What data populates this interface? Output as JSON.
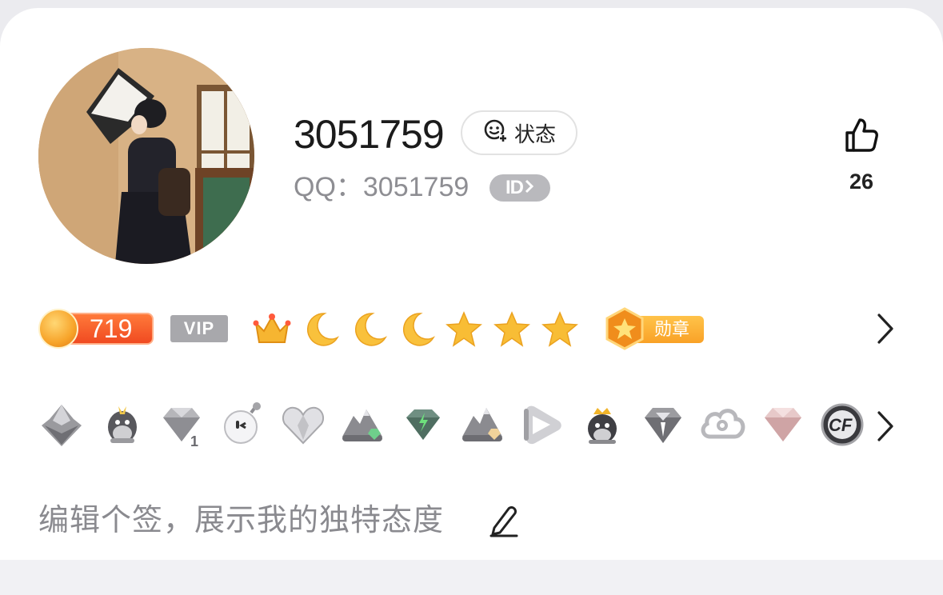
{
  "profile": {
    "nickname": "3051759",
    "status_label": "状态",
    "qq_line": "QQ：3051759",
    "id_badge": "ID",
    "like_count": "26",
    "signature": "编辑个签，展示我的独特态度"
  },
  "level": {
    "coin_value": "719",
    "vip_label": "VIP",
    "medal_label": "勋章",
    "icons": [
      "crown-icon",
      "moon-icon",
      "moon-icon",
      "moon-icon",
      "star-icon",
      "star-icon",
      "star-icon"
    ]
  },
  "badges": [
    "game-badge-icon",
    "qq-penguin-icon",
    "diamond-badge-icon",
    "bomb-face-icon",
    "heart-diamond-icon",
    "mountain-badge-icon",
    "green-diamond-icon",
    "mountain-badge-icon",
    "play-icon",
    "crowned-penguin-icon",
    "diamond-badge-icon",
    "cloud-icon",
    "pink-diamond-icon",
    "cf-badge-icon"
  ],
  "colors": {
    "coin_orange": "#f04a21",
    "gold": "#f7b733",
    "vip_gray": "#a8a8ac"
  }
}
